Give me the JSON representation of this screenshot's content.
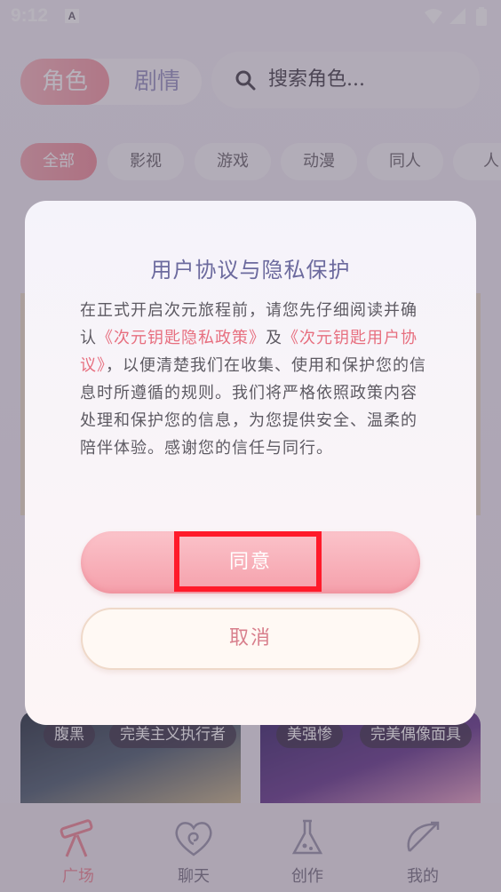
{
  "status_bar": {
    "time": "9:12",
    "notification_badge": "A"
  },
  "segment": {
    "active": "角色",
    "inactive": "剧情"
  },
  "search": {
    "placeholder": "搜索角色..."
  },
  "categories": [
    "全部",
    "影视",
    "游戏",
    "动漫",
    "同人",
    "人"
  ],
  "cards": [
    {
      "tags": [
        "腹黑",
        "完美主义执行者"
      ]
    },
    {
      "tags": [
        "美强惨",
        "完美偶像面具"
      ]
    }
  ],
  "tabbar": [
    {
      "label": "广场",
      "icon": "telescope-icon",
      "active": true
    },
    {
      "label": "聊天",
      "icon": "heart-swirl-icon",
      "active": false
    },
    {
      "label": "创作",
      "icon": "flask-icon",
      "active": false
    },
    {
      "label": "我的",
      "icon": "bow-arrow-icon",
      "active": false
    }
  ],
  "dialog": {
    "title": "用户协议与隐私保护",
    "body_part1": "在正式开启次元旅程前，请您先仔细阅读并确认",
    "link_privacy": "《次元钥匙隐私政策》",
    "body_part2": "及",
    "link_terms": "《次元钥匙用户协议》",
    "body_part3": "，以便清楚我们在收集、使用和保护您的信息时所遵循的规则。我们将严格依照政策内容处理和保护您的信息，为您提供安全、温柔的陪伴体验。感谢您的信任与同行。",
    "agree_label": "同意",
    "cancel_label": "取消"
  },
  "colors": {
    "accent_pink": "#f49aa5",
    "title_purple": "#6c6a9e",
    "link_red": "#e76f7f",
    "highlight_red": "#ff1a2a"
  }
}
